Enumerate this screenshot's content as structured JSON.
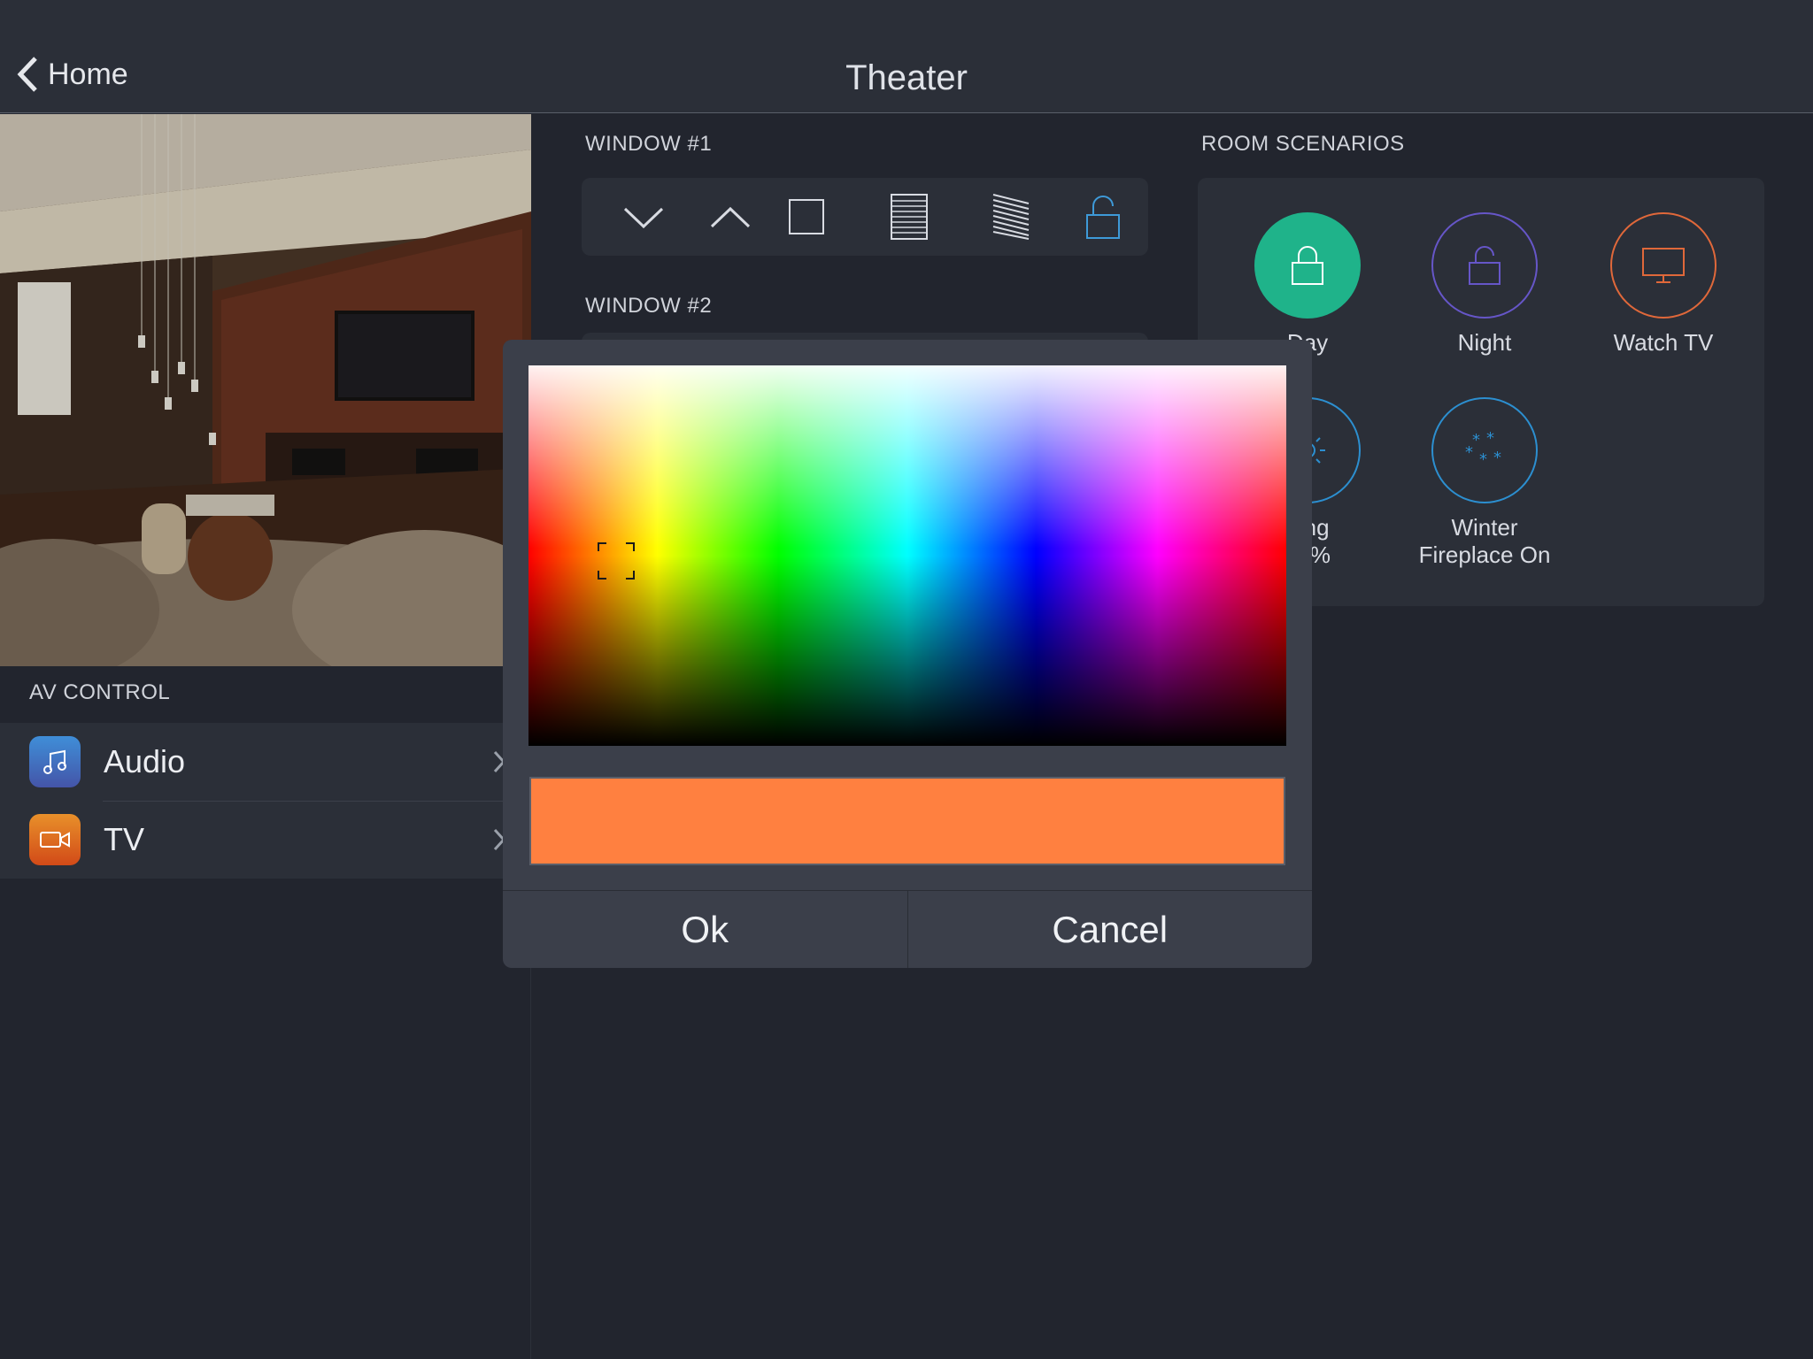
{
  "header": {
    "back_label": "Home",
    "title": "Theater"
  },
  "photo": {
    "alt": "living room"
  },
  "av_control": {
    "heading": "AV CONTROL",
    "items": [
      {
        "label": "Audio",
        "icon": "music-note-icon"
      },
      {
        "label": "TV",
        "icon": "video-camera-icon"
      }
    ]
  },
  "window1": {
    "label": "WINDOW #1"
  },
  "window2": {
    "label": "WINDOW #2"
  },
  "room_scenarios": {
    "heading": "ROOM SCENARIOS",
    "items": [
      {
        "label": "Day",
        "color": "#1fb38a"
      },
      {
        "label": "Night",
        "color": "#6656c8"
      },
      {
        "label": "Watch TV",
        "color": "#e0683a"
      },
      {
        "label_line1": "ning",
        "label_line2": "40%",
        "color": "#2c8fd0"
      },
      {
        "label_line1": "Winter",
        "label_line2": "Fireplace On",
        "color": "#2c8fd0"
      }
    ]
  },
  "color_dialog": {
    "selected_color": "#ff8040",
    "ok_label": "Ok",
    "cancel_label": "Cancel"
  }
}
